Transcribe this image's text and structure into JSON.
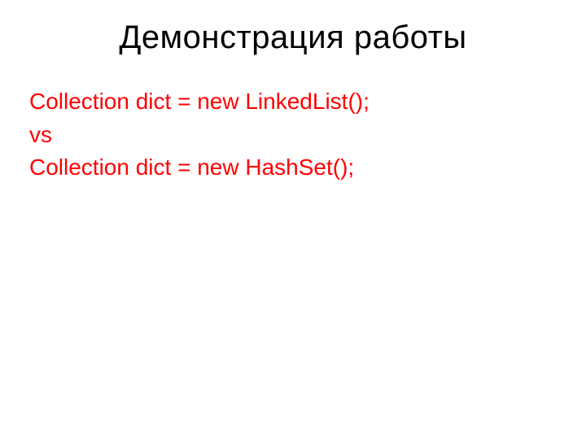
{
  "title": "Демонстрация работы",
  "lines": [
    "Collection dict = new LinkedList();",
    "vs",
    "Collection dict = new HashSet();"
  ]
}
